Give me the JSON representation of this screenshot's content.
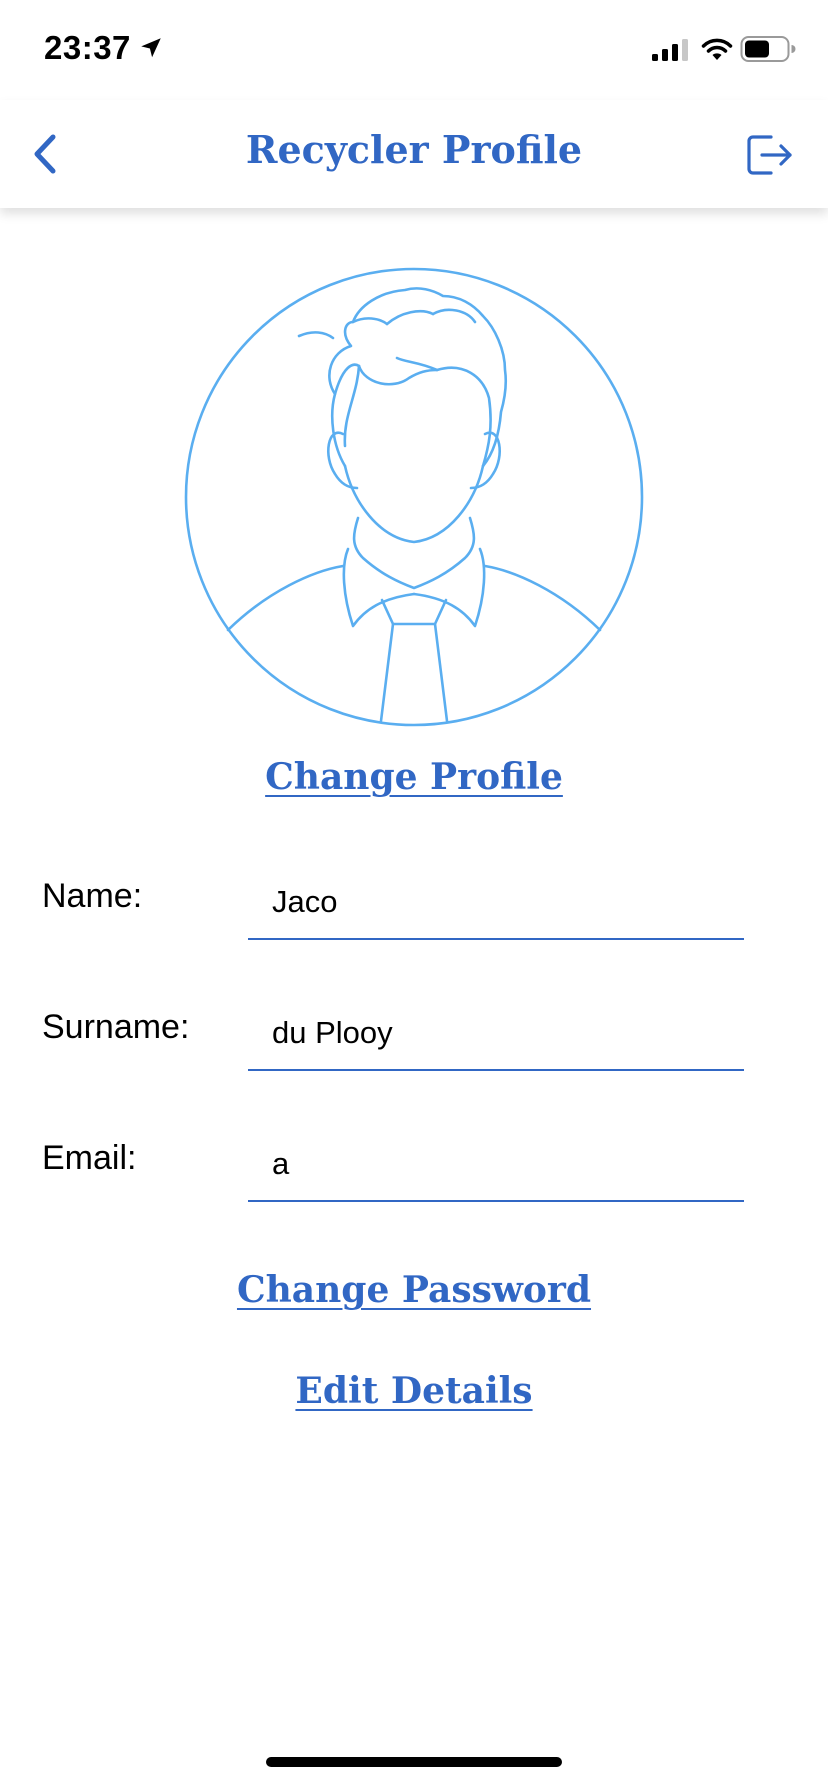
{
  "status_bar": {
    "time": "23:37",
    "icons": [
      "location-arrow-icon",
      "cellular-signal-icon",
      "wifi-icon",
      "battery-icon"
    ]
  },
  "nav": {
    "title": "Recycler Profile",
    "back_icon": "chevron-left-icon",
    "logout_icon": "logout-icon"
  },
  "profile": {
    "avatar_icon": "user-avatar-icon",
    "change_profile_label": "Change Profile"
  },
  "form": {
    "name": {
      "label": "Name:",
      "value": "Jaco"
    },
    "surname": {
      "label": "Surname:",
      "value": "du Plooy"
    },
    "email": {
      "label": "Email:",
      "value": "a"
    }
  },
  "actions": {
    "change_password_label": "Change Password",
    "edit_details_label": "Edit Details"
  },
  "colors": {
    "accent": "#3167c4",
    "avatar_line": "#5aaef0",
    "background": "#ffffff"
  }
}
